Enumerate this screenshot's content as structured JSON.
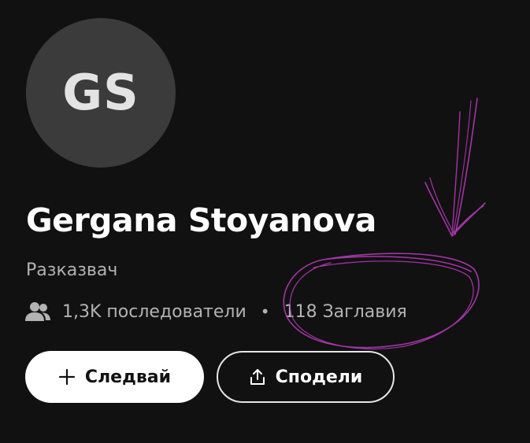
{
  "profile": {
    "initials": "GS",
    "name": "Gergana Stoyanova",
    "role": "Разказвач",
    "followers": "1,3K последователи",
    "separator": "•",
    "titles": "118 Заглавия"
  },
  "actions": {
    "follow_label": "Следвай",
    "share_label": "Сподели"
  },
  "icons": {
    "followers": "users-icon",
    "follow": "plus-icon",
    "share": "share-upload-icon"
  },
  "annotation": {
    "kind": "hand-drawn arrow and circle highlighting the titles count",
    "color": "#b23ab8"
  },
  "colors": {
    "background": "#121111",
    "avatar_bg": "#3b3b3b",
    "primary_text": "#ffffff",
    "secondary_text": "#b3b3b3",
    "follow_button_bg": "#ffffff",
    "share_button_border": "#e6e6e6"
  }
}
